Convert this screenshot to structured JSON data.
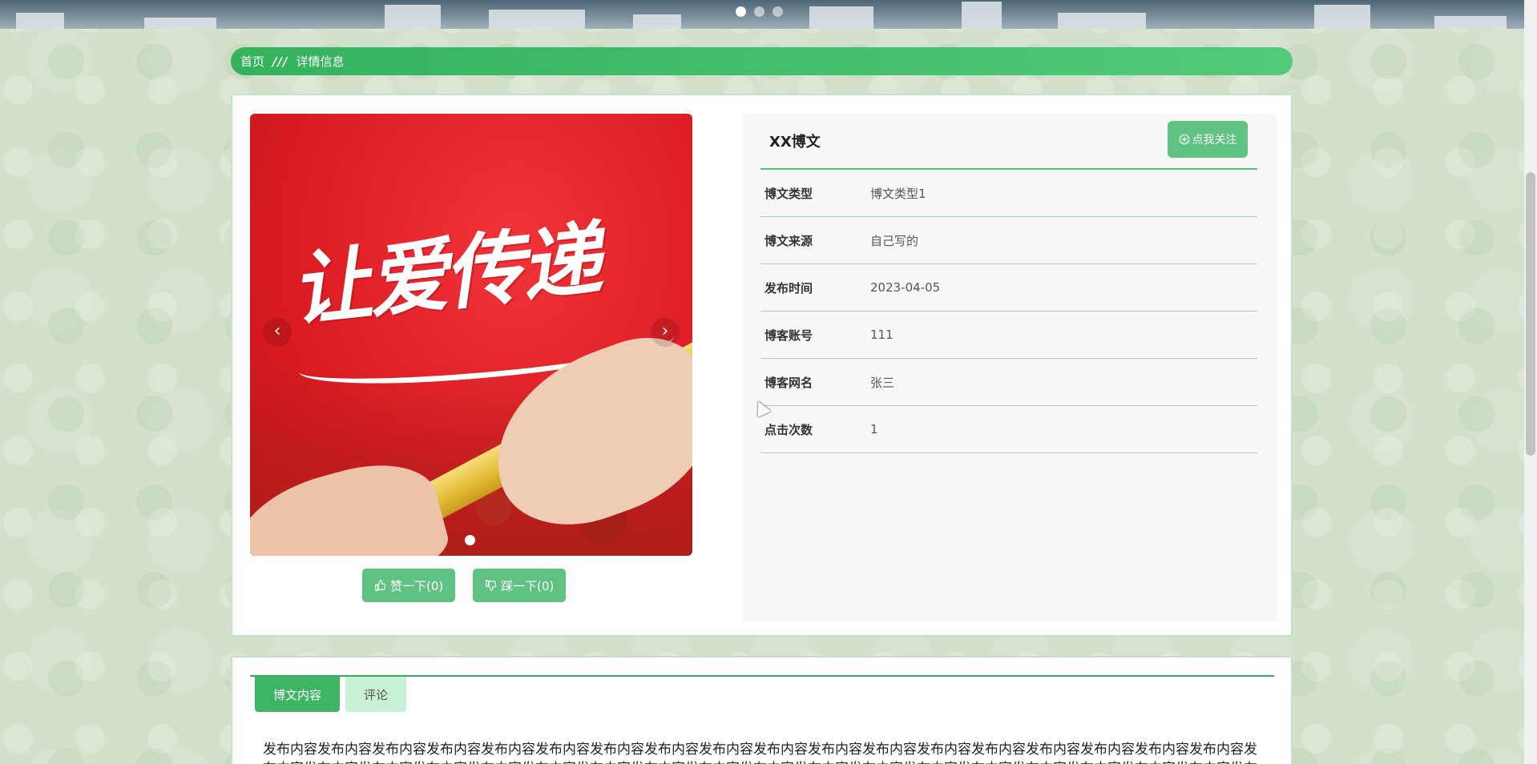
{
  "banner": {
    "dots": [
      true,
      false,
      false
    ]
  },
  "breadcrumb": {
    "home": "首页",
    "separator": "///",
    "current": "详情信息"
  },
  "carousel": {
    "slogan": "让爱传递",
    "prev": "‹",
    "next": "›"
  },
  "votes": {
    "like_icon": "thumbs-up-icon",
    "like_label": "赞一下(0)",
    "dislike_icon": "thumbs-down-icon",
    "dislike_label": "踩一下(0)"
  },
  "info": {
    "title": "XX博文",
    "follow_icon": "plus-circle-icon",
    "follow_label": "点我关注",
    "rows": [
      {
        "label": "博文类型",
        "value": "博文类型1"
      },
      {
        "label": "博文来源",
        "value": "自己写的"
      },
      {
        "label": "发布时间",
        "value": "2023-04-05"
      },
      {
        "label": "博客账号",
        "value": "111"
      },
      {
        "label": "博客网名",
        "value": "张三"
      },
      {
        "label": "点击次数",
        "value": "1"
      }
    ]
  },
  "tabs": {
    "content": "博文内容",
    "comments": "评论"
  },
  "content": {
    "text": "发布内容发布内容发布内容发布内容发布内容发布内容发布内容发布内容发布内容发布内容发布内容发布内容发布内容发布内容发布内容发布内容发布内容发布内容发布内容发布内容发布内容发布内容发布内容发布内容发布内容发布内容发布内容发布内容发布内容发布内容发布内容发布内容发布内容发布内容发布内容发布内容发布内容发布内容发布内容"
  },
  "colors": {
    "primary_green": "#3db565",
    "button_green": "#5fc182",
    "tab_inactive": "#c9f1d6",
    "carousel_red": "#dd1d24"
  }
}
